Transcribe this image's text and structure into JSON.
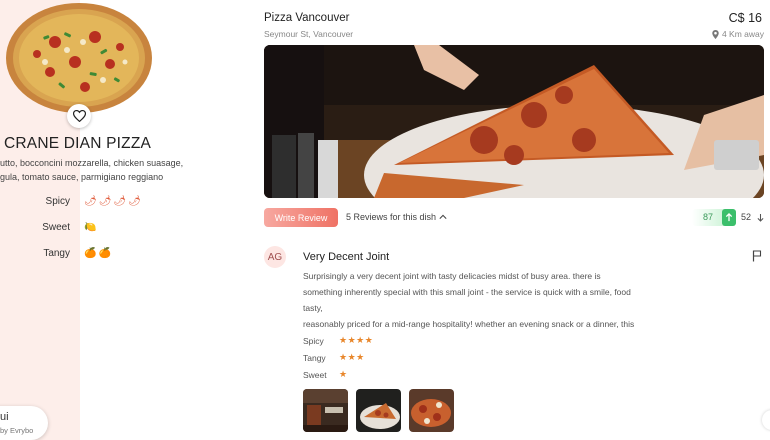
{
  "dish": {
    "name": "CRANE DIAN PIZZA",
    "ingredients_line1": "utto, bocconcini mozzarella, chicken suasage,",
    "ingredients_line2": "gula, tomato sauce, parmigiano reggiano",
    "flavors": [
      {
        "label": "Spicy",
        "icons": "🌶🌶🌶🌶",
        "icon": "chili-icon"
      },
      {
        "label": "Sweet",
        "icons": "🍋",
        "icon": "lemon-icon"
      },
      {
        "label": "Tangy",
        "icons": "🍊🍊",
        "icon": "orange-icon"
      }
    ]
  },
  "user": {
    "name": "ui",
    "sub": "by Evrybo"
  },
  "restaurant": {
    "name": "Pizza Vancouver",
    "address": "Seymour St, Vancouver",
    "price": "C$ 16",
    "distance": "4 Km away"
  },
  "reviews_bar": {
    "write_review": "Write Review",
    "count_text": "5 Reviews for this dish",
    "upvotes": "87",
    "downvotes": "52"
  },
  "review": {
    "avatar": "AG",
    "title": "Very Decent Joint",
    "body_lines": [
      "Surprisingly a very decent joint with tasty delicacies midst of busy area. there is",
      "something inherently special with this small joint - the service is quick with a smile, food",
      "tasty,",
      "reasonably priced for a mid-range hospitality! whether an evening snack or a dinner, this"
    ],
    "ratings": [
      {
        "label": "Spicy",
        "stars": 4,
        "stars_text": "★★★★"
      },
      {
        "label": "Tangy",
        "stars": 3,
        "stars_text": "★★★"
      },
      {
        "label": "Sweet",
        "stars": 1,
        "stars_text": "★"
      }
    ]
  },
  "colors": {
    "accent": "#ef7265",
    "left_panel_bg": "#fdeeea",
    "upvote": "#3bbf6b",
    "star": "#e8862a"
  }
}
